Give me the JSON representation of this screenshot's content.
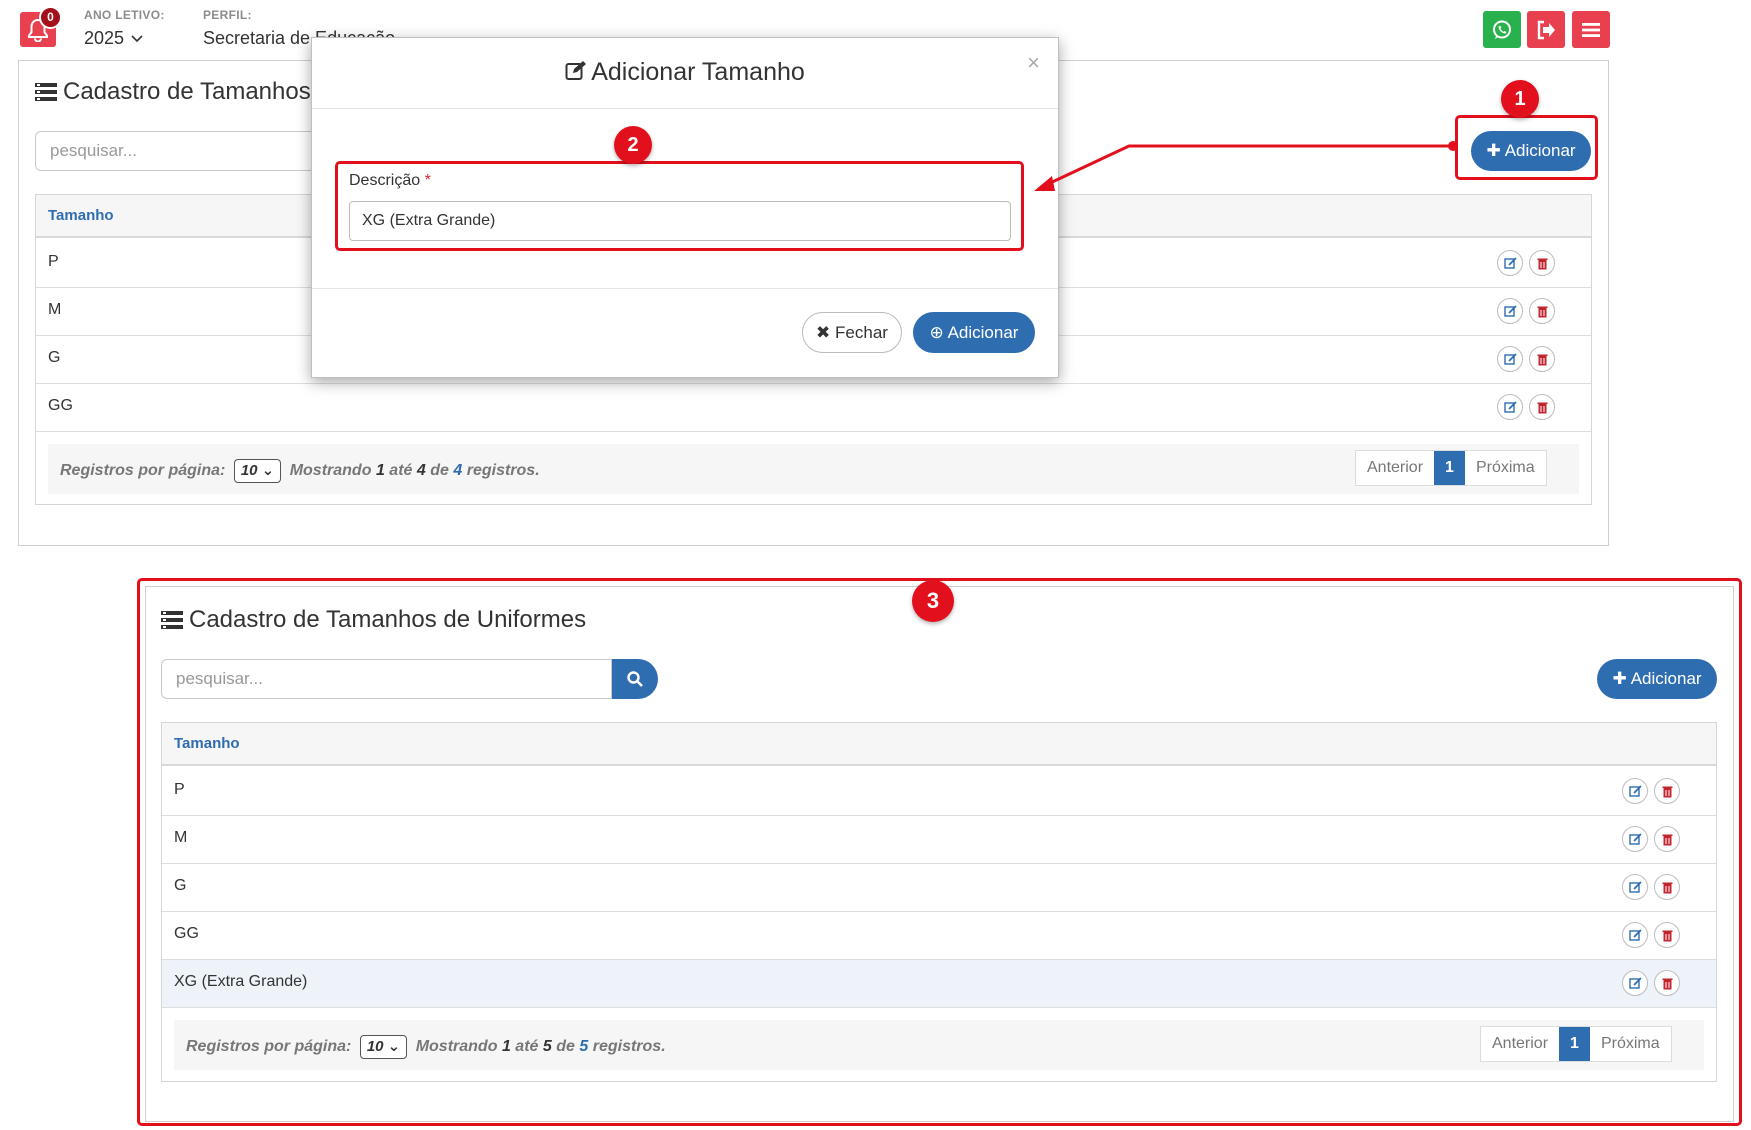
{
  "topbar": {
    "notification_count": "0",
    "ano_letivo_label": "ANO LETIVO:",
    "ano_letivo_value": "2025",
    "perfil_label": "PERFIL:",
    "perfil_value": "Secretaria de Educação",
    "colors": {
      "alert": "#e8404f",
      "whatsapp": "#28b14c",
      "logout": "#e8404f",
      "menu": "#e8404f"
    },
    "icons": [
      "bell-icon",
      "chevron-down-icon",
      "whatsapp-icon",
      "logout-icon",
      "menu-icon"
    ]
  },
  "background_panel": {
    "title": "Cadastro de Tamanhos de Uniformes",
    "title_visible": "Cadastro de Tamanhos d",
    "search_placeholder": "pesquisar...",
    "add_label": "Adicionar",
    "column_header": "Tamanho",
    "rows": [
      "P",
      "M",
      "G",
      "GG"
    ],
    "footer": {
      "per_page_label": "Registros por página:",
      "per_page_value": "10",
      "showing": "Mostrando",
      "from": "1",
      "ate": "até",
      "to": "4",
      "de": "de",
      "total": "4",
      "registros": "registros."
    },
    "pager": {
      "prev": "Anterior",
      "current": "1",
      "next": "Próxima"
    }
  },
  "modal": {
    "title": "Adicionar Tamanho",
    "close": "×",
    "field_label": "Descrição",
    "required_mark": "*",
    "field_value": "XG (Extra Grande)",
    "close_button": "Fechar",
    "add_button": "Adicionar"
  },
  "result_panel": {
    "title": "Cadastro de Tamanhos de Uniformes",
    "search_placeholder": "pesquisar...",
    "add_label": "Adicionar",
    "column_header": "Tamanho",
    "rows": [
      "P",
      "M",
      "G",
      "GG",
      "XG (Extra Grande)"
    ],
    "footer": {
      "per_page_label": "Registros por página:",
      "per_page_value": "10",
      "showing": "Mostrando",
      "from": "1",
      "ate": "até",
      "to": "5",
      "de": "de",
      "total": "5",
      "registros": "registros."
    },
    "pager": {
      "prev": "Anterior",
      "current": "1",
      "next": "Próxima"
    }
  },
  "annotations": {
    "step1": "1",
    "step2": "2",
    "step3": "3",
    "color": "#e2101d"
  },
  "accent_color": "#2f6db1"
}
